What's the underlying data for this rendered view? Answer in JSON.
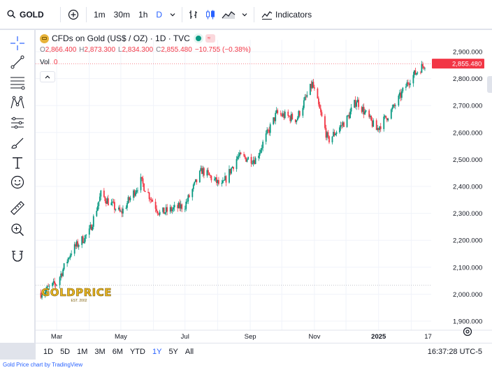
{
  "toolbar": {
    "symbol": "GOLD",
    "intervals": [
      "1m",
      "30m",
      "1h",
      "D"
    ],
    "active_interval": "D",
    "indicators_label": "Indicators"
  },
  "legend": {
    "title": "CFDs on Gold (US$ / OZ) · 1D · TVC",
    "open_label": "O",
    "open": "2,866.400",
    "high_label": "H",
    "high": "2,873.300",
    "low_label": "L",
    "low": "2,834.300",
    "close_label": "C",
    "close": "2,855.480",
    "change": "−10.755 (−0.38%)",
    "vol_label": "Vol",
    "vol": "0"
  },
  "watermark": {
    "brand": "GOLDPRICE",
    "tagline": "EST. 2002"
  },
  "price_axis": {
    "ticks": [
      "2,900.000",
      "2,800.000",
      "2,700.000",
      "2,600.000",
      "2,500.000",
      "2,400.000",
      "2,300.000",
      "2,200.000",
      "2,100.000",
      "2,000.000",
      "1,900.000"
    ],
    "last_price": "2,855.480"
  },
  "time_axis": {
    "labels": [
      "Mar",
      "May",
      "Jul",
      "Sep",
      "Nov",
      "2025",
      "17"
    ]
  },
  "ranges": [
    "1D",
    "5D",
    "1M",
    "3M",
    "6M",
    "YTD",
    "1Y",
    "5Y",
    "All"
  ],
  "active_range": "1Y",
  "clock": "16:37:28 UTC-5",
  "footer": "Gold Price chart by TradingView",
  "colors": {
    "up": "#089981",
    "down": "#f23645",
    "accent": "#2962ff"
  },
  "chart_data": {
    "type": "candlestick",
    "title": "CFDs on Gold (US$ / OZ) · 1D · TVC",
    "ylim": [
      1900,
      2900
    ],
    "last_close": 2855.48,
    "x": [
      "2024-02-15",
      "2024-03-01",
      "2024-03-15",
      "2024-04-01",
      "2024-04-12",
      "2024-05-01",
      "2024-05-20",
      "2024-06-07",
      "2024-07-01",
      "2024-07-17",
      "2024-08-05",
      "2024-08-20",
      "2024-09-06",
      "2024-09-26",
      "2024-10-15",
      "2024-10-30",
      "2024-11-14",
      "2024-12-02",
      "2024-12-11",
      "2024-12-30",
      "2025-01-15",
      "2025-01-31",
      "2025-02-14"
    ],
    "close": [
      2005,
      2040,
      2160,
      2230,
      2370,
      2300,
      2420,
      2300,
      2330,
      2460,
      2400,
      2510,
      2500,
      2670,
      2650,
      2780,
      2570,
      2650,
      2720,
      2610,
      2690,
      2800,
      2855
    ]
  }
}
